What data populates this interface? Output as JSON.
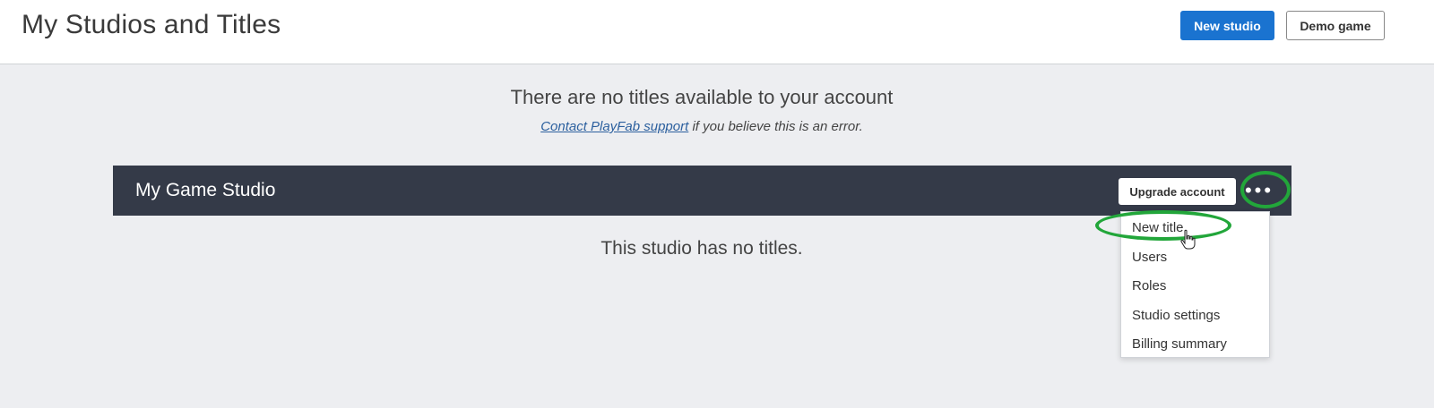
{
  "header": {
    "title": "My Studios and Titles",
    "new_studio_label": "New studio",
    "demo_game_label": "Demo game"
  },
  "notice": {
    "title": "There are no titles available to your account",
    "support_link": "Contact PlayFab support",
    "support_suffix": " if you believe this is an error."
  },
  "studio": {
    "name": "My Game Studio",
    "upgrade_label": "Upgrade account",
    "more_label": "•••",
    "empty_message": "This studio has no titles."
  },
  "menu": {
    "items": [
      {
        "label": "New title"
      },
      {
        "label": "Users"
      },
      {
        "label": "Roles"
      },
      {
        "label": "Studio settings"
      },
      {
        "label": "Billing summary"
      }
    ]
  },
  "colors": {
    "primary": "#1a73d0",
    "studio_bar": "#343a48",
    "highlight": "#22a63a",
    "background": "#edeef1"
  }
}
